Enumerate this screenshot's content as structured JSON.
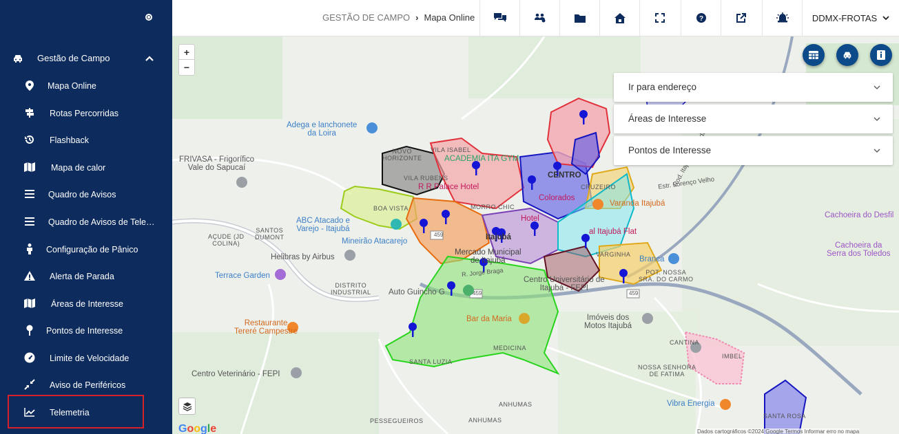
{
  "sidebar": {
    "section": {
      "label": "Gestão de Campo"
    },
    "items": [
      {
        "label": "Mapa Online",
        "icon": "map-pin-icon"
      },
      {
        "label": "Rotas Percorridas",
        "icon": "signpost-icon"
      },
      {
        "label": "Flashback",
        "icon": "history-icon"
      },
      {
        "label": "Mapa de calor",
        "icon": "map-icon"
      },
      {
        "label": "Quadro de Avisos",
        "icon": "list-icon"
      },
      {
        "label": "Quadro de Avisos de Telemetria",
        "icon": "list-icon"
      },
      {
        "label": "Configuração de Pânico",
        "icon": "person-icon"
      },
      {
        "label": "Alerta de Parada",
        "icon": "warning-icon"
      },
      {
        "label": "Áreas de Interesse",
        "icon": "map-icon"
      },
      {
        "label": "Pontos de Interesse",
        "icon": "pin-icon"
      },
      {
        "label": "Limite de Velocidade",
        "icon": "speedometer-icon"
      },
      {
        "label": "Aviso de Periféricos",
        "icon": "compress-icon"
      },
      {
        "label": "Telemetria",
        "icon": "chart-line-icon"
      }
    ]
  },
  "topbar": {
    "breadcrumb": {
      "parent": "GESTÃO DE CAMPO",
      "current": "Mapa Online"
    },
    "buttons": [
      "chat-icon",
      "users-icon",
      "folder-icon",
      "home-icon",
      "fullscreen-icon",
      "help-icon",
      "external-link-icon",
      "alarm-icon"
    ],
    "company": "DDMX-FROTAS"
  },
  "map": {
    "zoom_in": "+",
    "zoom_out": "−",
    "panels": [
      {
        "label": "Ir para endereço"
      },
      {
        "label": "Áreas de Interesse"
      },
      {
        "label": "Pontos de Interesse"
      }
    ],
    "labels": {
      "adega": "Adega e lanchonete\nda Loira",
      "frivasa": "FRIVASA - Frigorífico\nVale do Sapucaí",
      "novo_horizonte": "NOVO\nHORIZONTE",
      "vila_isabel": "VILA ISABEL",
      "academia": "ACADEMIA ITA GYM",
      "vila_rubens": "VILA RUBENS",
      "rr_palace": "R R Palace Hotel",
      "boa_vista": "BOA VISTA",
      "abc": "ABC Atacado e\nVarejo - Itajubá",
      "mineirao": "Mineirão Atacarejo",
      "santos_dumont": "SANTOS\nDUMONT",
      "acude": "AÇUDE (JD\nCOLINA)",
      "helibras": "Helibras by Airbus",
      "terrace": "Terrace Garden",
      "distrito": "DISTRITO\nINDUSTRIAL",
      "auto_guincho": "Auto Guincho G",
      "restaurante": "Restaurante\nTereré Campestre",
      "bar_da_maria": "Bar da Maria",
      "medicina": "MEDICINA",
      "santa_luzia": "SANTA LUZIA",
      "centro_vet": "Centro Veterinário - FEPI",
      "anhumas1": "ANHUMAS",
      "anhumas2": "ANHUMAS",
      "pessegueiros": "PESSEGUEIROS",
      "centro": "CENTRO",
      "cruzeiro": "CRUZEIRO",
      "varanda": "Varanda Itajubá",
      "flat": "al Itajubá Flat",
      "varginha": "VARGINHA",
      "branca": "Branca",
      "pot_nossa": "POT. NOSSA\nSRA. DO CARMO",
      "centro_univ": "Centro Universitário de\nItajubá - FEPI",
      "imoveis": "Imóveis dos\nMotos Itajubá",
      "cantina": "CANTINA",
      "imbel": "IMBEL",
      "nossa_fatima": "NOSSA SENHORA\nDE FATIMA",
      "vibra": "Vibra Energia",
      "santa_rosa": "SANTA ROSA",
      "estr_lorenco": "Estr. Lorenço Velho",
      "rod_itajuba": "Rod. Itajubá Maria da Fé",
      "cachoeira_desfil": "Cachoeira do Desfil",
      "cachoeira_serra": "Cachoeira da\nSerra dos Toledos",
      "mercado": "Mercado Municipal\nde Itajubá",
      "moro": "MORRO CHIC",
      "route_459a": "459",
      "route_459b": "459",
      "route_459c": "459",
      "cor": "Colorados",
      "hotel_small": "Hotel",
      "ita": "Itajubá",
      "jorge": "R. Jorge Braga"
    },
    "google": "Google",
    "attribution": "Dados cartográficos ©2024 Google   Termos   Informar erro no mapa"
  }
}
